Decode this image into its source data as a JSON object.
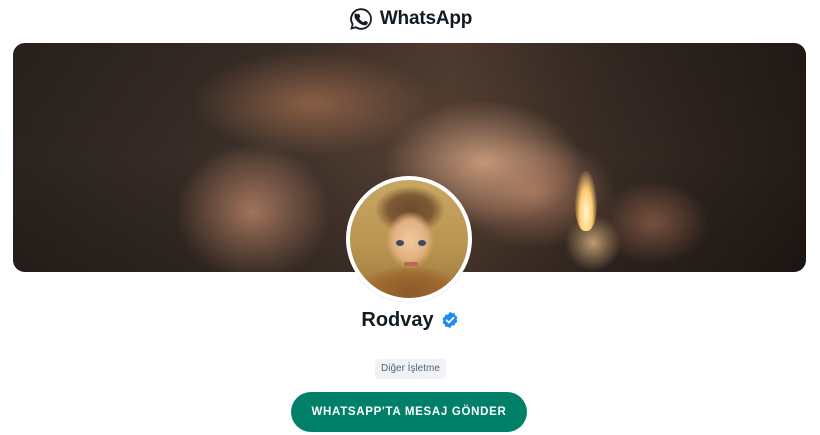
{
  "header": {
    "logo_icon": "whatsapp-logo-icon",
    "logo_text": "WhatsApp"
  },
  "cover": {
    "image": "cover-photo"
  },
  "profile": {
    "avatar": "profile-avatar",
    "name": "Rodvay",
    "verified_icon": "verified-badge-icon",
    "category": "Diğer İşletme"
  },
  "cta": {
    "label": "WHATSAPP'TA MESAJ GÖNDER"
  },
  "colors": {
    "brand_green": "#008069",
    "verified_blue": "#1d8cf0",
    "text_dark": "#111b21",
    "pill_bg": "#f0f2f5"
  }
}
